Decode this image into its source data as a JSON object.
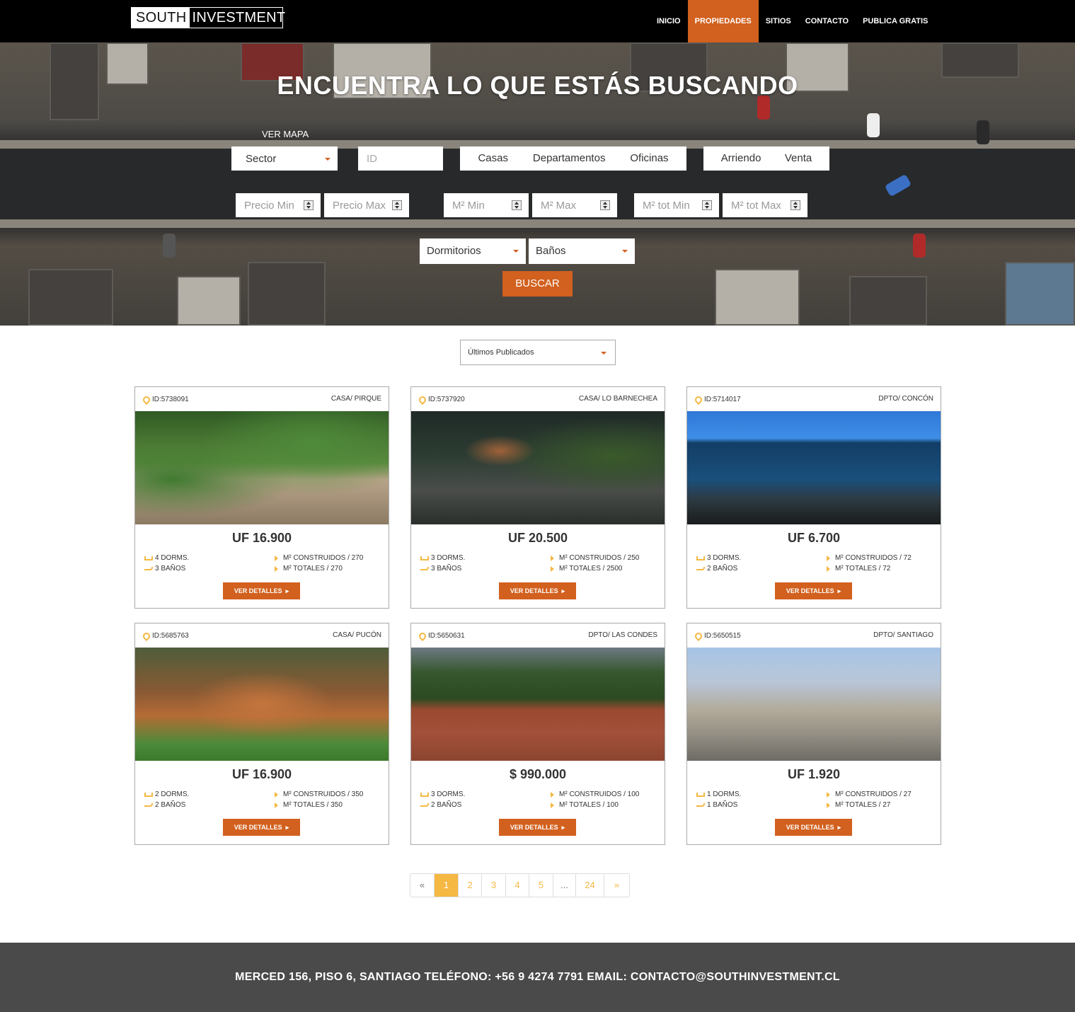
{
  "brand": {
    "part1": "SOUTH",
    "part2": "INVESTMENT"
  },
  "nav": {
    "items": [
      {
        "label": "INICIO"
      },
      {
        "label": "PROPIEDADES",
        "active": true
      },
      {
        "label": "SITIOS"
      },
      {
        "label": "CONTACTO"
      },
      {
        "label": "PUBLICA GRATIS"
      }
    ]
  },
  "hero": {
    "title": "ENCUENTRA LO QUE ESTÁS BUSCANDO",
    "map_link": "VER MAPA",
    "sector": "Sector",
    "id_placeholder": "ID",
    "types": [
      "Casas",
      "Departamentos",
      "Oficinas"
    ],
    "operation": [
      "Arriendo",
      "Venta"
    ],
    "precio_min": "Precio Min",
    "precio_max": "Precio Max",
    "m2_min": "M² Min",
    "m2_max": "M² Max",
    "m2_tot_min": "M² tot Min",
    "m2_tot_max": "M² tot Max",
    "dormitorios": "Dormitorios",
    "banos": "Baños",
    "search_button": "BUSCAR"
  },
  "sort": {
    "selected": "Últimos Publicados"
  },
  "listings": [
    {
      "id": "ID:5738091",
      "type": "CASA/ PIRQUE",
      "photo": "garden-house",
      "price": "UF 16.900",
      "dorms": "4 DORMS.",
      "banos": "3 BAÑOS",
      "construidos": "M² CONSTRUIDOS / 270",
      "totales": "M² TOTALES / 270",
      "button": "VER DETALLES"
    },
    {
      "id": "ID:5737920",
      "type": "CASA/ LO BARNECHEA",
      "photo": "dark-house",
      "price": "UF 20.500",
      "dorms": "3 DORMS.",
      "banos": "3 BAÑOS",
      "construidos": "M² CONSTRUIDOS / 250",
      "totales": "M² TOTALES / 2500",
      "button": "VER DETALLES"
    },
    {
      "id": "ID:5714017",
      "type": "DPTO/ CONCÓN",
      "photo": "sea-view",
      "price": "UF 6.700",
      "dorms": "3 DORMS.",
      "banos": "2 BAÑOS",
      "construidos": "M² CONSTRUIDOS / 72",
      "totales": "M² TOTALES / 72",
      "button": "VER DETALLES"
    },
    {
      "id": "ID:5685763",
      "type": "CASA/ PUCÓN",
      "photo": "wood-cabin",
      "price": "UF 16.900",
      "dorms": "2 DORMS.",
      "banos": "2 BAÑOS",
      "construidos": "M² CONSTRUIDOS / 350",
      "totales": "M² TOTALES / 350",
      "button": "VER DETALLES"
    },
    {
      "id": "ID:5650631",
      "type": "DPTO/ LAS CONDES",
      "photo": "brick-wall",
      "price": "$ 990.000",
      "dorms": "3 DORMS.",
      "banos": "2 BAÑOS",
      "construidos": "M² CONSTRUIDOS / 100",
      "totales": "M² TOTALES / 100",
      "button": "VER DETALLES"
    },
    {
      "id": "ID:5650515",
      "type": "DPTO/ SANTIAGO",
      "photo": "apartment-tower",
      "price": "UF 1.920",
      "dorms": "1 DORMS.",
      "banos": "1 BAÑOS",
      "construidos": "M² CONSTRUIDOS / 27",
      "totales": "M² TOTALES / 27",
      "button": "VER DETALLES"
    }
  ],
  "pagination": {
    "prev": "«",
    "pages": [
      "1",
      "2",
      "3",
      "4",
      "5"
    ],
    "current": "1",
    "ellipsis": "...",
    "last": "24",
    "next": "»"
  },
  "footer": {
    "text": "MERCED 156, PISO 6, SANTIAGO TELÉFONO: +56 9 4274 7791 EMAIL: CONTACTO@SOUTHINVESTMENT.CL"
  },
  "colors": {
    "accent": "#d2601e",
    "highlight": "#f5b843",
    "header": "#000000",
    "footer": "#4a4a4a"
  }
}
